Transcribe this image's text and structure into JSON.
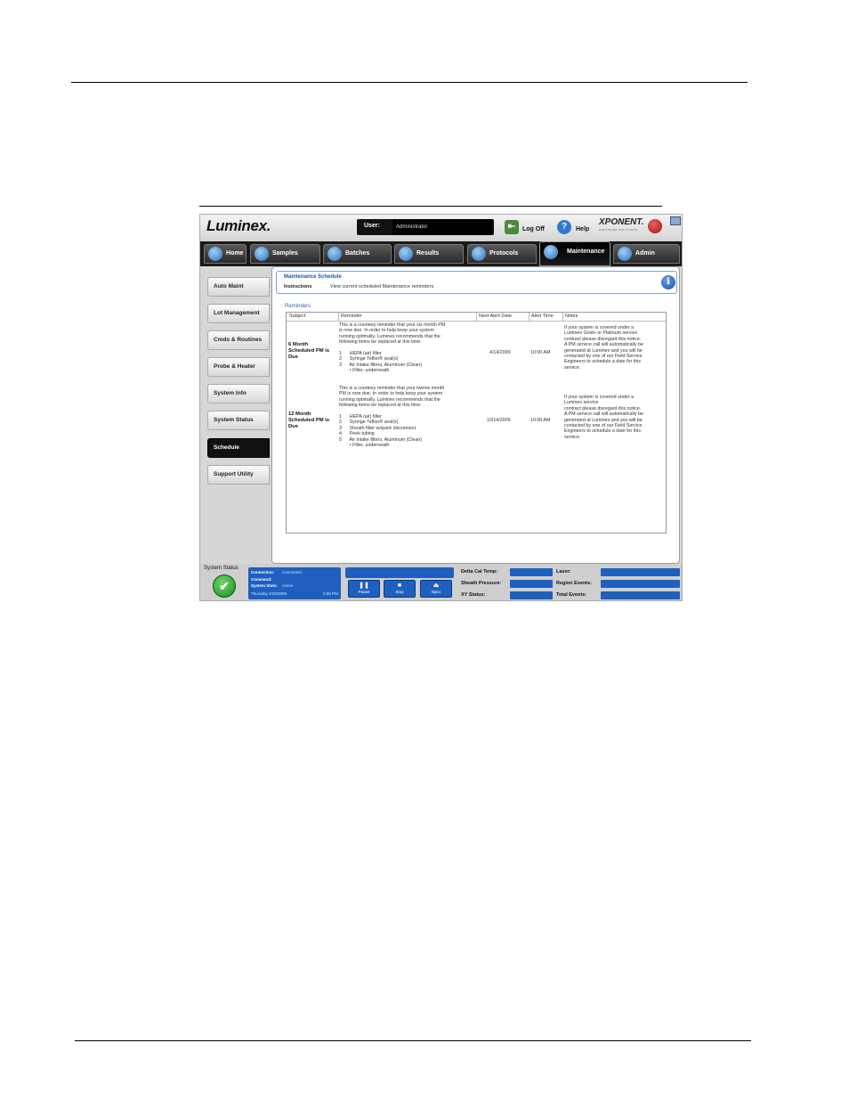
{
  "header": {
    "logo": "Luminex.",
    "user_label": "User:",
    "user_value": "Administrator",
    "logoff_label": "Log Off",
    "help_label": "Help",
    "xponent": "XPONENT.",
    "xponent_sub": "SOFTWARE SOLUTIONS"
  },
  "tabs": [
    {
      "label": "Home"
    },
    {
      "label": "Samples"
    },
    {
      "label": "Batches"
    },
    {
      "label": "Results"
    },
    {
      "label": "Protocols"
    },
    {
      "label": "Maintenance",
      "active": true
    },
    {
      "label": "Admin"
    }
  ],
  "sidebar": {
    "items": [
      {
        "label": "Auto Maint"
      },
      {
        "label": "Lot Management"
      },
      {
        "label": "Cmds & Routines"
      },
      {
        "label": "Probe & Heater"
      },
      {
        "label": "System Info"
      },
      {
        "label": "System Status"
      },
      {
        "label": "Schedule",
        "active": true
      },
      {
        "label": "Support Utility"
      }
    ]
  },
  "main": {
    "title": "Maintenance Schedule",
    "instructions_label": "Instructions",
    "instructions_text": "View current scheduled Maintenance reminders.",
    "reminders_legend": "Reminders",
    "columns": [
      "Subject",
      "Reminder",
      "Next Alert Date",
      "Alert Time",
      "Notes"
    ],
    "rows": [
      {
        "subject": [
          "6 Month",
          "Scheduled PM is",
          "Due"
        ],
        "reminder": [
          "This is a courtesy reminder that your six month PM",
          "is now due. In order to help keep your system",
          "running optimally, Luminex recommends that the",
          "following items be replaced at this time:",
          "",
          "1      HEPA (air) filter",
          "2      Syringe Teflon® seal(s)",
          "3      Air Intake filters, Aluminum (Clean)",
          "        • Filter, underneath"
        ],
        "date": "4/14/2009",
        "time": "10:00 AM",
        "notes": [
          "If your system is covered under a",
          "Luminex Gold+ or Platinum service",
          "contract please disregard this notice.",
          "A PM service call will automatically be",
          "generated at Luminex and you will be",
          "contacted by one of our Field Service",
          "Engineers to schedule a date for this",
          "service."
        ]
      },
      {
        "subject": [
          "12 Month",
          "Scheduled PM is",
          "Due"
        ],
        "reminder": [
          "This is a courtesy reminder that your twelve month",
          "PM is now due. In order to help keep your system",
          "running optimally, Luminex recommends that the",
          "following items be replaced at this time:",
          "",
          "1      HEPA (air) filter",
          "2      Syringe Teflon® seal(s)",
          "3      Sheath filter w/quick disconnect",
          "4      Peek tubing",
          "5      Air Intake filters, Aluminum (Clean)",
          "        • Filter, underneath"
        ],
        "date": "10/14/2009",
        "time": "10:00 AM",
        "notes": [
          "If your system is covered under a",
          "Luminex service",
          "contract please disregard this notice.",
          "A PM service call will automatically be",
          "generated at Luminex and you will be",
          "contacted by one of our Field Service",
          "Engineers to schedule a date for this",
          "service."
        ]
      }
    ]
  },
  "status_bar": {
    "system_status_label": "System Status",
    "connection_label": "Connection:",
    "connection_value": "Connected",
    "command_label": "Command:",
    "system_state_label": "System State:",
    "system_state_value": "Active",
    "datetime": "Thursday 4/30/2009",
    "time": "4:08 PM",
    "pause_label": "Pause",
    "stop_label": "Stop",
    "eject_label": "Eject",
    "delta_cal_label": "Delta Cal Temp:",
    "sheath_label": "Sheath Pressure:",
    "xy_label": "XY Status:",
    "laser_label": "Laser:",
    "region_label": "Region Events:",
    "total_label": "Total Events:"
  }
}
